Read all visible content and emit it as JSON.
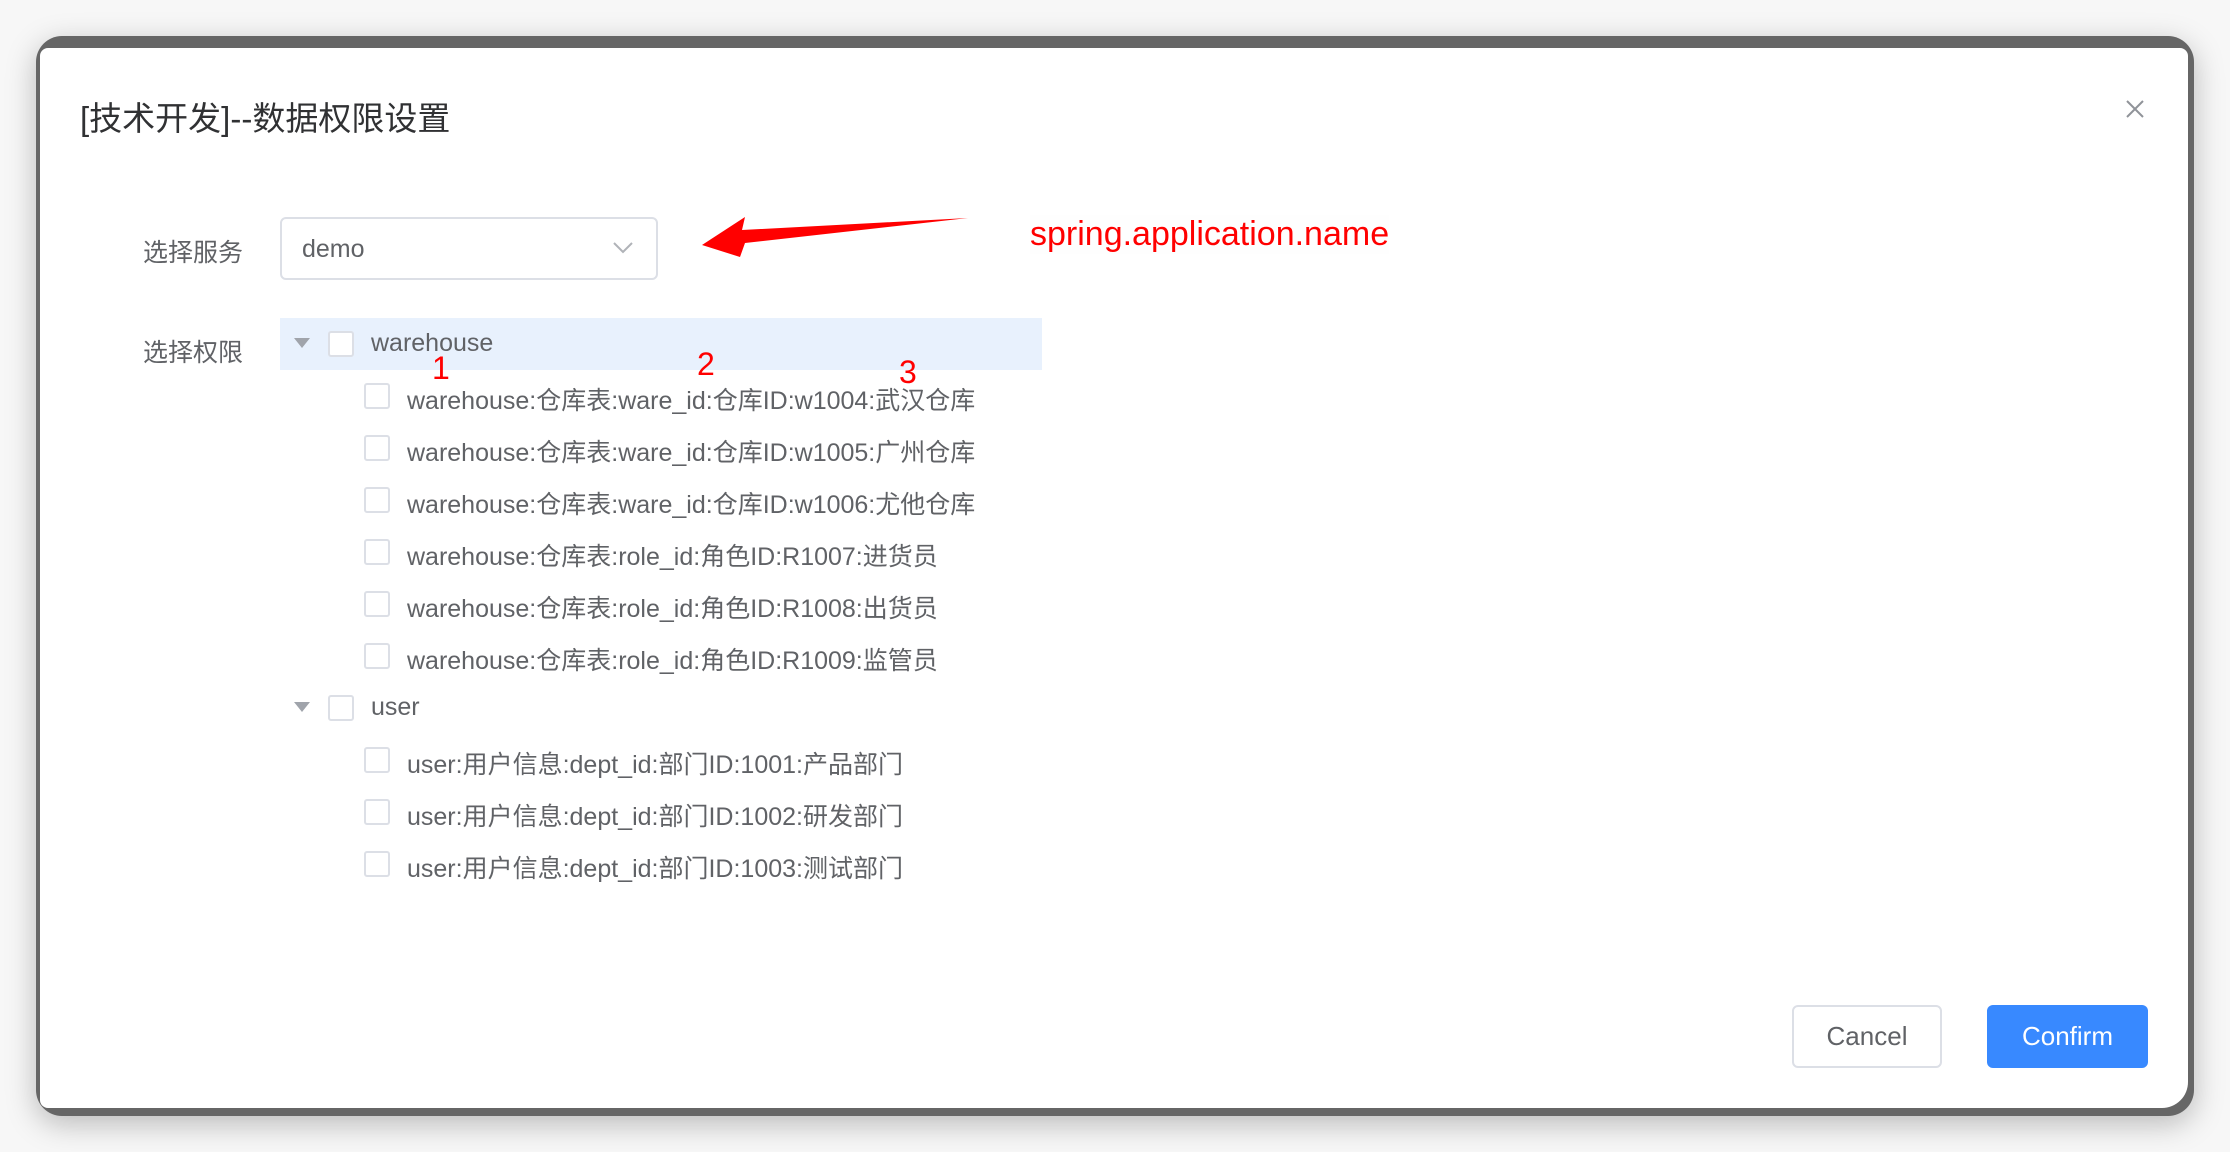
{
  "dialog": {
    "title": "[技术开发]--数据权限设置"
  },
  "form": {
    "service_label": "选择服务",
    "service_value": "demo",
    "permission_label": "选择权限"
  },
  "annotation": {
    "text": "spring.application.name",
    "numbers": [
      "1",
      "2",
      "3"
    ],
    "color": "#ff0000"
  },
  "tree": [
    {
      "label": "warehouse",
      "children": [
        "warehouse:仓库表:ware_id:仓库ID:w1004:武汉仓库",
        "warehouse:仓库表:ware_id:仓库ID:w1005:广州仓库",
        "warehouse:仓库表:ware_id:仓库ID:w1006:尤他仓库",
        "warehouse:仓库表:role_id:角色ID:R1007:进货员",
        "warehouse:仓库表:role_id:角色ID:R1008:出货员",
        "warehouse:仓库表:role_id:角色ID:R1009:监管员"
      ]
    },
    {
      "label": "user",
      "children": [
        "user:用户信息:dept_id:部门ID:1001:产品部门",
        "user:用户信息:dept_id:部门ID:1002:研发部门",
        "user:用户信息:dept_id:部门ID:1003:测试部门"
      ]
    }
  ],
  "footer": {
    "cancel": "Cancel",
    "confirm": "Confirm"
  },
  "colors": {
    "primary": "#3889ff",
    "highlight": "#e8f1fd"
  }
}
